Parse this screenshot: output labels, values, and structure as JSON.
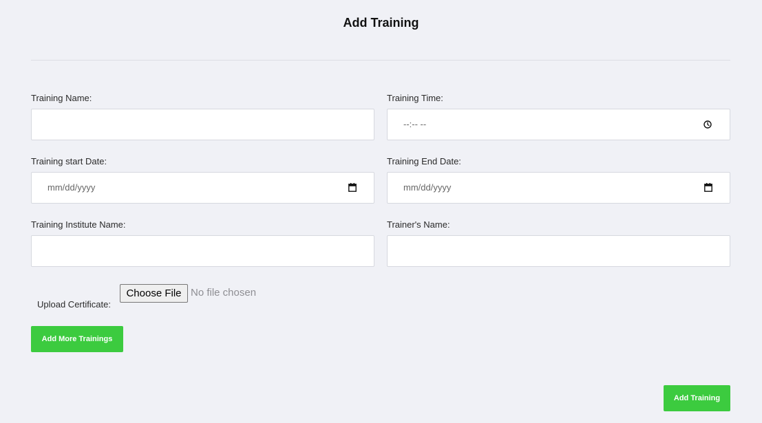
{
  "page": {
    "title": "Add Training"
  },
  "form": {
    "training_name": {
      "label": "Training Name:",
      "value": ""
    },
    "training_time": {
      "label": "Training Time:",
      "placeholder": "--:-- --",
      "icon": "clock-icon"
    },
    "start_date": {
      "label": "Training start Date:",
      "placeholder": "mm/dd/yyyy",
      "icon": "calendar-icon"
    },
    "end_date": {
      "label": "Training End Date:",
      "placeholder": "mm/dd/yyyy",
      "icon": "calendar-icon"
    },
    "institute_name": {
      "label": "Training Institute Name:",
      "value": ""
    },
    "trainer_name": {
      "label": "Trainer's Name:",
      "value": ""
    },
    "upload": {
      "label": "Upload Certificate:",
      "button_label": "Choose File",
      "status": "No file chosen"
    }
  },
  "actions": {
    "add_more_label": "Add More Trainings",
    "submit_label": "Add Training"
  },
  "colors": {
    "accent_green": "#3ccb3f",
    "background": "#f0f1f6"
  }
}
